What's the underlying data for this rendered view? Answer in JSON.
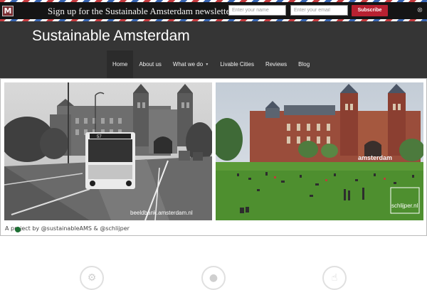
{
  "newsletter_bar": {
    "logo_letter": "M",
    "title": "Sign up for the Sustainable Amsterdam newsletter",
    "name_placeholder": "Enter your name",
    "email_placeholder": "Enter your email",
    "subscribe_label": "Subscribe",
    "close_symbol": "⊗"
  },
  "header": {
    "site_title": "Sustainable Amsterdam",
    "nav": [
      {
        "label": "Home",
        "active": true
      },
      {
        "label": "About us"
      },
      {
        "label": "What we do"
      },
      {
        "label": "Livable Cities"
      },
      {
        "label": "Reviews"
      },
      {
        "label": "Blog"
      }
    ]
  },
  "gallery": {
    "left_image_watermark": "beeldbank.amsterdam.nl",
    "right_image_watermark": "schlijper.nl",
    "right_image_sign": "amsterdam",
    "bus_sign": "57",
    "credit": "A project by @sustainableAMS & @schlijper"
  },
  "features": {
    "icons": [
      "gear-icon",
      "user-icon",
      "thumbs-up-icon"
    ]
  },
  "colors": {
    "top_bar": "#151515",
    "header": "#353535",
    "subscribe": "#b72131",
    "nav_active": "#2b2b2b"
  }
}
